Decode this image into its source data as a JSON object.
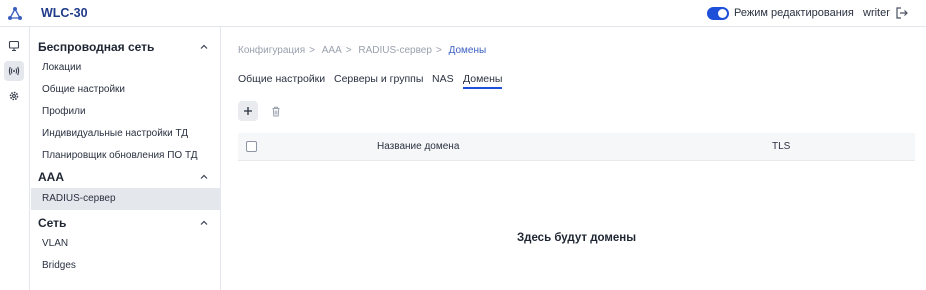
{
  "header": {
    "title": "WLC-30",
    "edit_mode_label": "Режим редактирования",
    "edit_mode_on": true,
    "user": "writer",
    "accent": "#1d4fd8"
  },
  "rail": {
    "items": [
      {
        "icon": "monitor-icon",
        "active": false
      },
      {
        "icon": "wireless-icon",
        "active": true
      },
      {
        "icon": "gear-icon",
        "active": false
      }
    ]
  },
  "sidebar": {
    "sections": [
      {
        "label": "Беспроводная сеть",
        "items": [
          {
            "label": "Локации"
          },
          {
            "label": "Общие настройки"
          },
          {
            "label": "Профили"
          },
          {
            "label": "Индивидуальные настройки ТД"
          },
          {
            "label": "Планировщик обновления ПО ТД"
          }
        ]
      },
      {
        "label": "AAA",
        "items": [
          {
            "label": "RADIUS-сервер",
            "active": true
          }
        ]
      },
      {
        "label": "Сеть",
        "items": [
          {
            "label": "VLAN"
          },
          {
            "label": "Bridges"
          }
        ]
      }
    ]
  },
  "breadcrumb": {
    "items": [
      "Конфигурация",
      "AAA",
      "RADIUS-сервер",
      "Домены"
    ],
    "separator": ">"
  },
  "tabs": [
    {
      "label": "Общие настройки"
    },
    {
      "label": "Серверы и группы"
    },
    {
      "label": "NAS"
    },
    {
      "label": "Домены",
      "active": true
    }
  ],
  "table": {
    "columns": [
      "Название домена",
      "TLS"
    ],
    "empty_text": "Здесь будут домены"
  }
}
